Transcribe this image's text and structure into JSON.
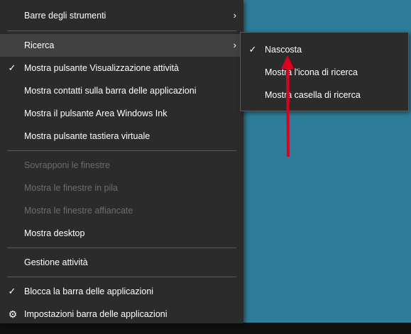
{
  "colors": {
    "desktop_bg": "#2d7d9a",
    "menu_bg": "#2b2b2b",
    "hover_bg": "#414141",
    "disabled_text": "#6d6d6d",
    "annotation_arrow": "#e0001b"
  },
  "menu": {
    "items": [
      {
        "label": "Barre degli strumenti",
        "submenu_icon": "chevron-right-icon"
      },
      {
        "label": "Ricerca",
        "submenu_icon": "chevron-right-icon",
        "state": "highlighted"
      },
      {
        "label": "Mostra pulsante Visualizzazione attività",
        "checked": true
      },
      {
        "label": "Mostra contatti sulla barra delle applicazioni"
      },
      {
        "label": "Mostra il pulsante Area Windows Ink"
      },
      {
        "label": "Mostra pulsante tastiera virtuale"
      },
      {
        "label": "Sovrapponi le finestre",
        "disabled": true
      },
      {
        "label": "Mostra le finestre in pila",
        "disabled": true
      },
      {
        "label": "Mostra le finestre affiancate",
        "disabled": true
      },
      {
        "label": "Mostra desktop"
      },
      {
        "label": "Gestione attività"
      },
      {
        "label": "Blocca la barra delle applicazioni",
        "checked": true
      },
      {
        "label": "Impostazioni barra delle applicazioni",
        "icon": "gear-icon"
      }
    ]
  },
  "submenu": {
    "items": [
      {
        "label": "Nascosta",
        "checked": true
      },
      {
        "label": "Mostra l'icona di ricerca"
      },
      {
        "label": "Mostra casella di ricerca"
      }
    ]
  },
  "glyphs": {
    "check": "✓",
    "chevron": "›",
    "gear": "⚙"
  }
}
